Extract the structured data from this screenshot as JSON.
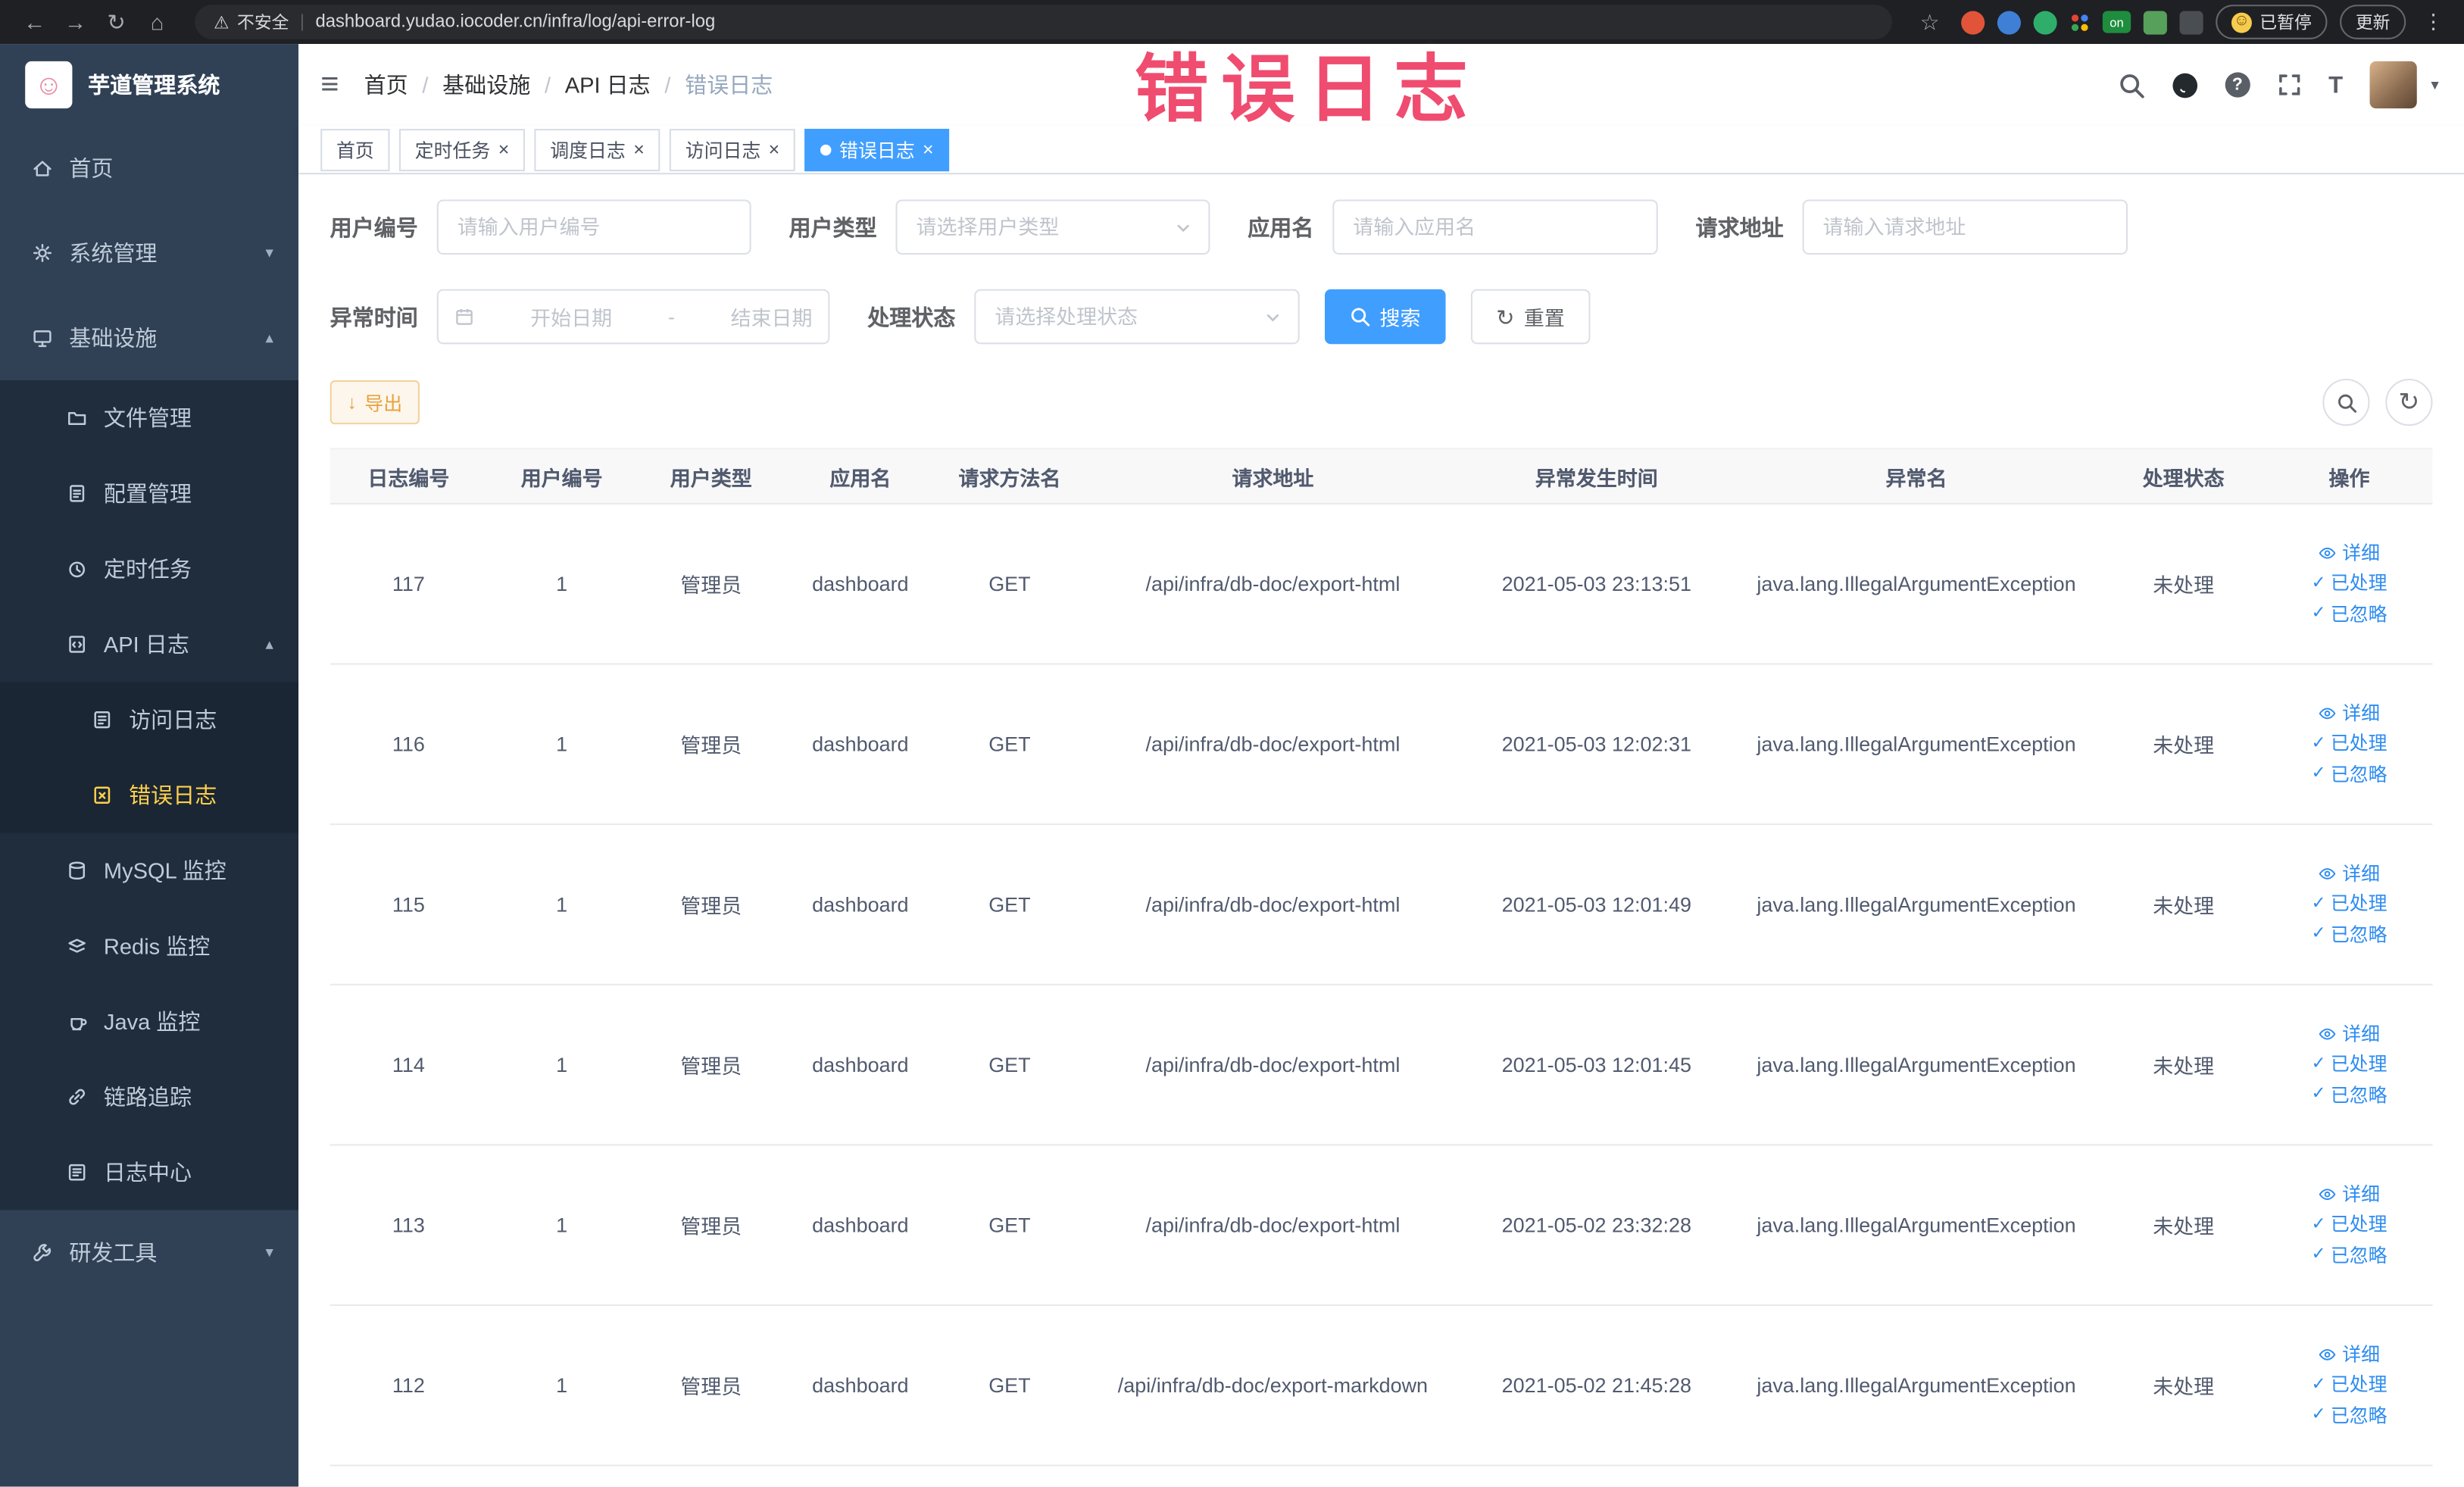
{
  "colors": {
    "primary": "#409eff",
    "warning": "#e6a23c",
    "sidebar_bg": "#304156",
    "sidebar_sub_bg": "#1f2d3d",
    "active_menu_text": "#ffd04b",
    "annotation": "#ee3d64"
  },
  "annotation": "错误日志",
  "browser": {
    "security": "不安全",
    "url": "dashboard.yudao.iocoder.cn/infra/log/api-error-log",
    "ext_on": "on",
    "paused": "已暂停",
    "update": "更新"
  },
  "icons": {
    "back": "←",
    "forward": "→",
    "reload": "↻",
    "home": "⌂",
    "warning": "⚠",
    "star": "☆",
    "overflow": "⋮",
    "hamburger": "≡",
    "caret_down": "▾",
    "caret_up": "▴",
    "close": "×",
    "check": "✓",
    "download": "↓",
    "refresh": "↻",
    "smile": "☺",
    "question": "?",
    "font_size": "T",
    "separator": "/"
  },
  "sidebar": {
    "title": "芋道管理系统",
    "home": "首页",
    "system": "系统管理",
    "infra": "基础设施",
    "file": "文件管理",
    "config": "配置管理",
    "job": "定时任务",
    "api_log": "API 日志",
    "access_log": "访问日志",
    "error_log": "错误日志",
    "mysql": "MySQL 监控",
    "redis": "Redis 监控",
    "java": "Java 监控",
    "trace": "链路追踪",
    "log_center": "日志中心",
    "dev": "研发工具"
  },
  "breadcrumb": [
    "首页",
    "基础设施",
    "API 日志",
    "错误日志"
  ],
  "tabs": [
    {
      "label": "首页"
    },
    {
      "label": "定时任务"
    },
    {
      "label": "调度日志"
    },
    {
      "label": "访问日志"
    },
    {
      "label": "错误日志"
    }
  ],
  "filters": {
    "user_id_label": "用户编号",
    "user_id_placeholder": "请输入用户编号",
    "user_type_label": "用户类型",
    "user_type_placeholder": "请选择用户类型",
    "app_label": "应用名",
    "app_placeholder": "请输入应用名",
    "url_label": "请求地址",
    "url_placeholder": "请输入请求地址",
    "time_label": "异常时间",
    "time_start": "开始日期",
    "time_separator": "-",
    "time_end": "结束日期",
    "status_label": "处理状态",
    "status_placeholder": "请选择处理状态",
    "search": "搜索",
    "reset": "重置"
  },
  "toolbar": {
    "export": "导出"
  },
  "table": {
    "columns": [
      "日志编号",
      "用户编号",
      "用户类型",
      "应用名",
      "请求方法名",
      "请求地址",
      "异常发生时间",
      "异常名",
      "处理状态",
      "操作"
    ],
    "actions": {
      "detail": "详细",
      "done": "已处理",
      "ignore": "已忽略"
    },
    "rows": [
      {
        "id": "117",
        "user_id": "1",
        "user_type": "管理员",
        "app": "dashboard",
        "method": "GET",
        "url": "/api/infra/db-doc/export-html",
        "time": "2021-05-03 23:13:51",
        "exception": "java.lang.IllegalArgumentException",
        "status": "未处理"
      },
      {
        "id": "116",
        "user_id": "1",
        "user_type": "管理员",
        "app": "dashboard",
        "method": "GET",
        "url": "/api/infra/db-doc/export-html",
        "time": "2021-05-03 12:02:31",
        "exception": "java.lang.IllegalArgumentException",
        "status": "未处理"
      },
      {
        "id": "115",
        "user_id": "1",
        "user_type": "管理员",
        "app": "dashboard",
        "method": "GET",
        "url": "/api/infra/db-doc/export-html",
        "time": "2021-05-03 12:01:49",
        "exception": "java.lang.IllegalArgumentException",
        "status": "未处理"
      },
      {
        "id": "114",
        "user_id": "1",
        "user_type": "管理员",
        "app": "dashboard",
        "method": "GET",
        "url": "/api/infra/db-doc/export-html",
        "time": "2021-05-03 12:01:45",
        "exception": "java.lang.IllegalArgumentException",
        "status": "未处理"
      },
      {
        "id": "113",
        "user_id": "1",
        "user_type": "管理员",
        "app": "dashboard",
        "method": "GET",
        "url": "/api/infra/db-doc/export-html",
        "time": "2021-05-02 23:32:28",
        "exception": "java.lang.IllegalArgumentException",
        "status": "未处理"
      },
      {
        "id": "112",
        "user_id": "1",
        "user_type": "管理员",
        "app": "dashboard",
        "method": "GET",
        "url": "/api/infra/db-doc/export-markdown",
        "time": "2021-05-02 21:45:28",
        "exception": "java.lang.IllegalArgumentException",
        "status": "未处理"
      }
    ]
  }
}
